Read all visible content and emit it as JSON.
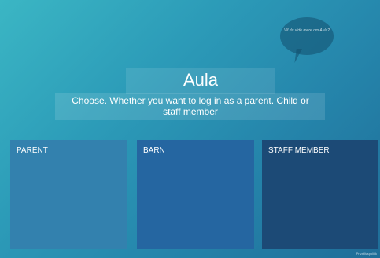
{
  "speech_bubble": {
    "text": "Vil du vide mere om Aula?"
  },
  "header": {
    "title": "Aula",
    "subtitle": "Choose. Whether you want to log in as a parent. Child or staff member"
  },
  "options": [
    {
      "label": "PARENT"
    },
    {
      "label": "BARN"
    },
    {
      "label": "STAFF MEMBER"
    }
  ],
  "footer": {
    "watermark": "Privatlivspolitik"
  },
  "colors": {
    "parent_card": "#3381ae",
    "barn_card": "#2566a1",
    "staff_card": "#1c4a76"
  }
}
